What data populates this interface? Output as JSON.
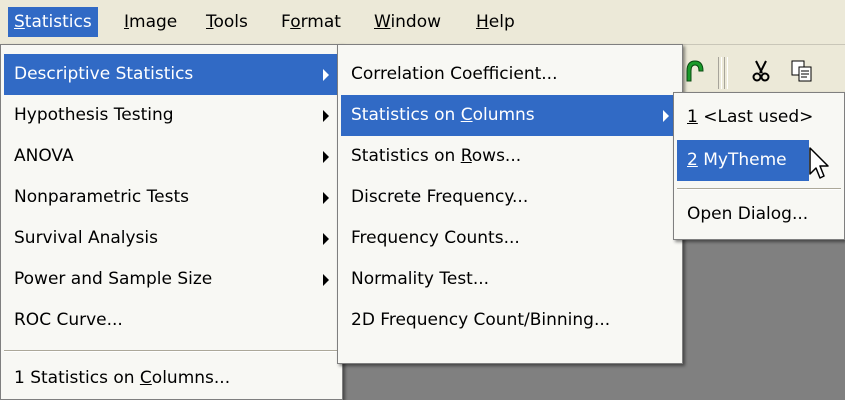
{
  "menubar": {
    "items": [
      {
        "label": "Statistics",
        "underline": "S",
        "rest": "tatistics"
      },
      {
        "label": "Image",
        "underline": "I",
        "rest": "mage"
      },
      {
        "label": "Tools",
        "underline": "T",
        "rest": "ools"
      },
      {
        "label": "Format",
        "pre": "F",
        "underline": "o",
        "rest": "rmat"
      },
      {
        "label": "Window",
        "underline": "W",
        "rest": "indow"
      },
      {
        "label": "Help",
        "underline": "H",
        "rest": "elp"
      }
    ]
  },
  "menu1": {
    "items": [
      "Descriptive Statistics",
      "Hypothesis Testing",
      "ANOVA",
      "Nonparametric Tests",
      "Survival Analysis",
      "Power and Sample Size",
      "ROC Curve..."
    ],
    "recent": {
      "pre": "1 Statistics on ",
      "underline": "C",
      "rest": "olumns..."
    }
  },
  "menu2": {
    "items": [
      {
        "label": "Correlation Coefficient..."
      },
      {
        "label": "Statistics on Columns",
        "pre": "Statistics on ",
        "underline": "C",
        "rest": "olumns"
      },
      {
        "label": "Statistics on Rows...",
        "pre": "Statistics on ",
        "underline": "R",
        "rest": "ows..."
      },
      {
        "label": "Discrete Frequency..."
      },
      {
        "label": "Frequency Counts..."
      },
      {
        "label": "Normality Test..."
      },
      {
        "label": "2D Frequency Count/Binning..."
      }
    ]
  },
  "menu3": {
    "items": [
      {
        "underline": "1",
        "rest": " <Last used>"
      },
      {
        "underline": "2",
        "rest": " MyTheme"
      }
    ],
    "open_dialog": "Open Dialog..."
  },
  "icons": [
    "green-arrow-icon",
    "cut-icon",
    "copy-icon",
    "mouse-pointer-icon"
  ],
  "colors": {
    "highlight": "#316ac5",
    "menu_bg": "#f8f8f4",
    "menubar_bg": "#ece9d8",
    "workspace": "#808080"
  }
}
